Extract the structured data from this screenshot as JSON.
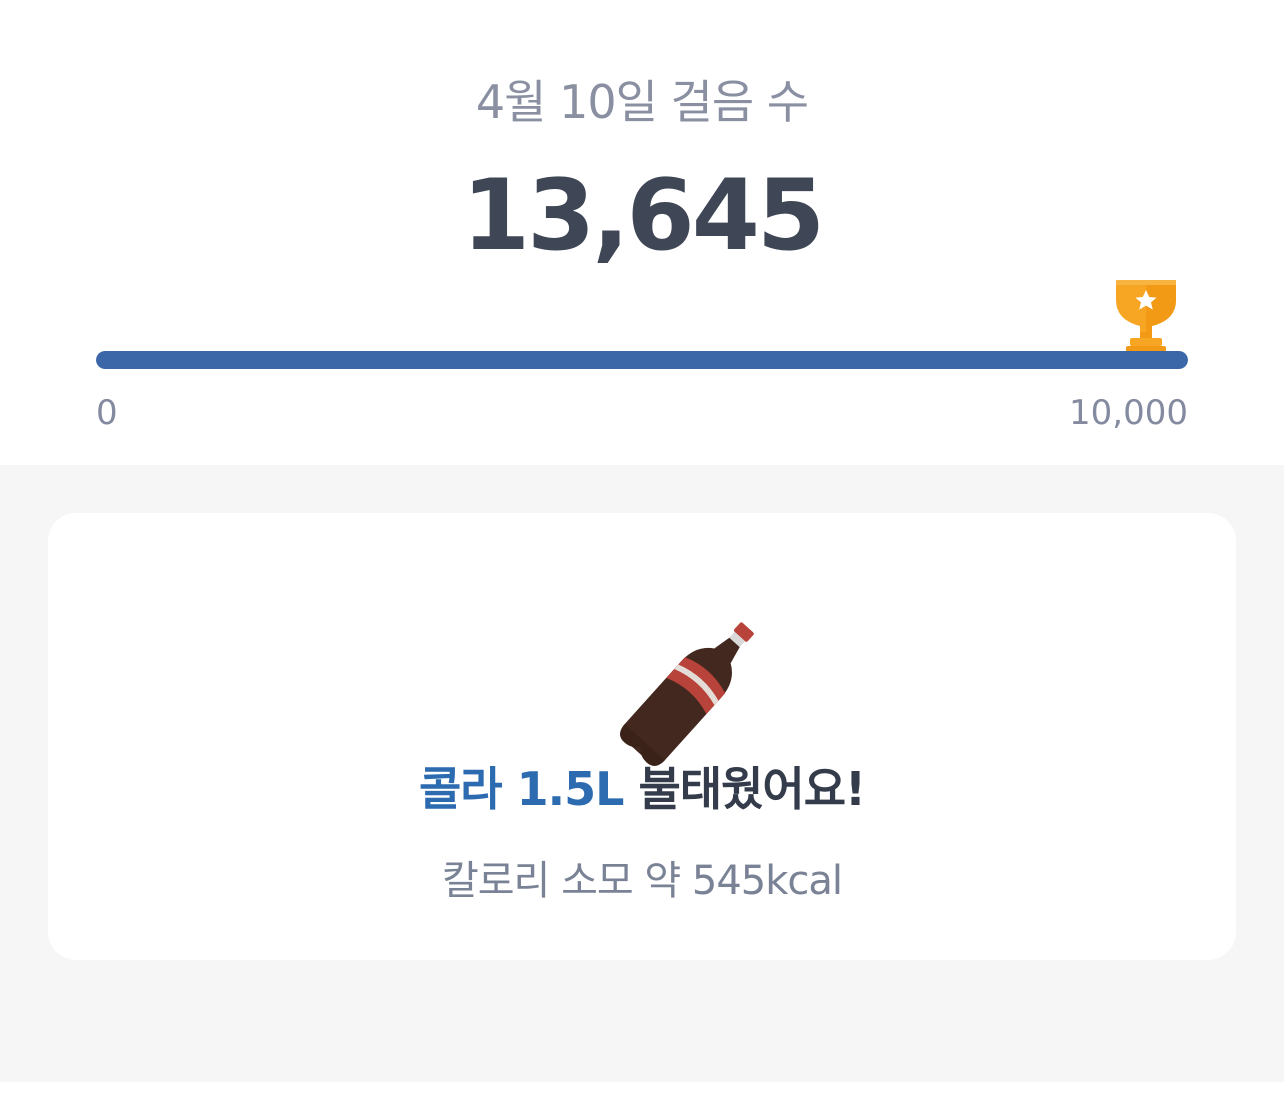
{
  "header": {
    "date_title": "4월 10일 걸음 수",
    "step_count": "13,645"
  },
  "progress": {
    "min_label": "0",
    "max_label": "10,000",
    "goal_fraction_filled": 1.0,
    "fill_color": "#3b67a8",
    "goal_icon": "trophy-icon"
  },
  "burn_card": {
    "icon": "cola-bottle-icon",
    "highlight": "콜라 1.5L",
    "suffix": " 불태웠어요!",
    "calorie_text": "칼로리 소모 약 545kcal",
    "accent_color": "#2d6bb0"
  }
}
